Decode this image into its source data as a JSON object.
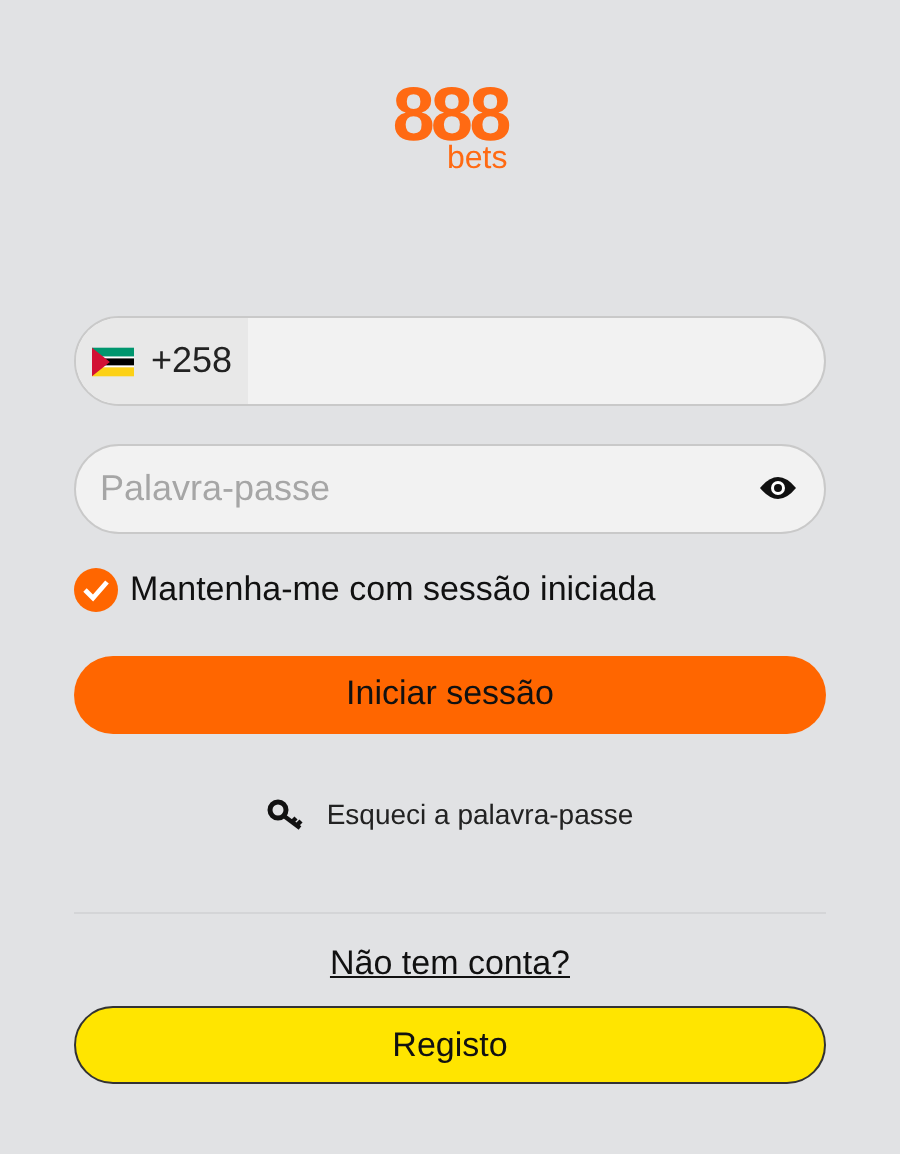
{
  "logo": {
    "digits": "888",
    "word": "bets"
  },
  "phone": {
    "country_code": "+258"
  },
  "password": {
    "placeholder": "Palavra-passe"
  },
  "remember": {
    "label": "Mantenha-me com sessão iniciada",
    "checked": true
  },
  "login_button": "Iniciar sessão",
  "forgot_link": "Esqueci a palavra-passe",
  "signup_prompt": "Não tem conta?",
  "register_button": "Registo"
}
